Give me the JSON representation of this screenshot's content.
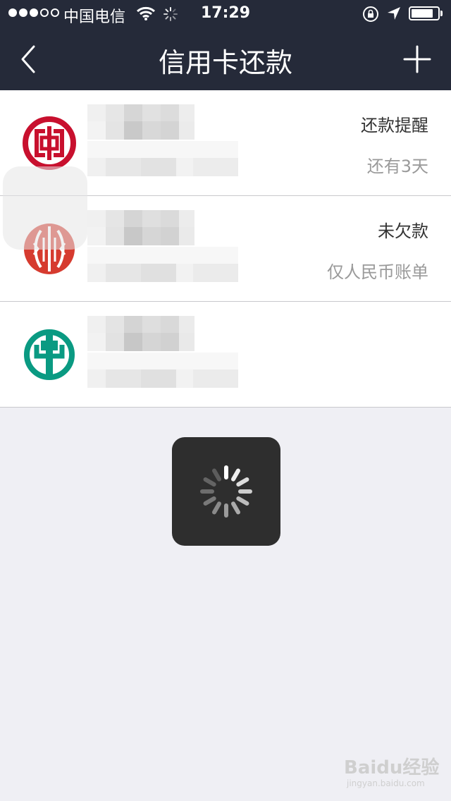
{
  "status_bar": {
    "carrier": "中国电信",
    "time": "17:29",
    "signal_bars_filled": 3,
    "signal_bars_total": 5,
    "battery_level": 0.8
  },
  "nav": {
    "title": "信用卡还款",
    "back_icon": "chevron-left-icon",
    "add_icon": "plus-icon"
  },
  "cards": [
    {
      "bank_icon": "icbc-logo",
      "logo_color": "#c8102e",
      "status_title": "还款提醒",
      "status_sub": "还有3天"
    },
    {
      "bank_icon": "citic-logo",
      "logo_color": "#d63b2f",
      "status_title": "未欠款",
      "status_sub": "仅人民币账单"
    },
    {
      "bank_icon": "abc-logo",
      "logo_color": "#0a9a82",
      "status_title": "",
      "status_sub": ""
    }
  ],
  "colors": {
    "nav_bg": "#252a39",
    "page_bg": "#efeff4",
    "spinner_bg": "#2e2e2e"
  },
  "watermark": {
    "main": "Baidu经验",
    "sub": "jingyan.baidu.com"
  }
}
